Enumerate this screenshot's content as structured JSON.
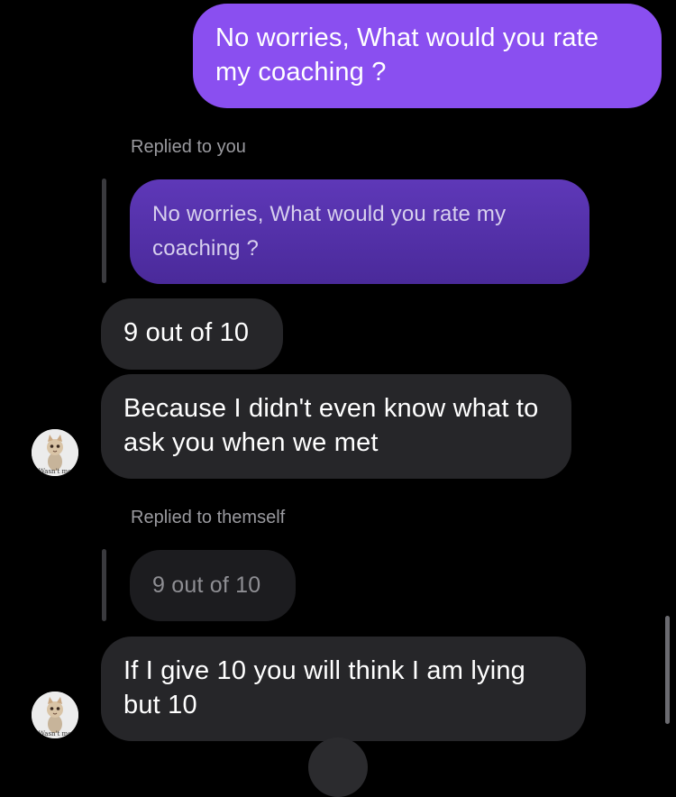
{
  "messages": {
    "sent_1": "No worries, What would you rate my coaching ?",
    "reply_label_1": "Replied to you",
    "quoted_1": "No worries, What would you rate my coaching ?",
    "recv_1": "9 out of 10",
    "recv_2": "Because I didn't even know what to ask you when we met",
    "reply_label_2": "Replied to themself",
    "quoted_2": "9 out of 10",
    "recv_3": "If I give 10 you will think I am lying but 10"
  },
  "avatar": {
    "caption": "Wasn't me",
    "icon": "cat-avatar-icon"
  },
  "colors": {
    "sent_bubble": "#8a4ff0",
    "received_bubble": "#262629",
    "background": "#000000"
  }
}
